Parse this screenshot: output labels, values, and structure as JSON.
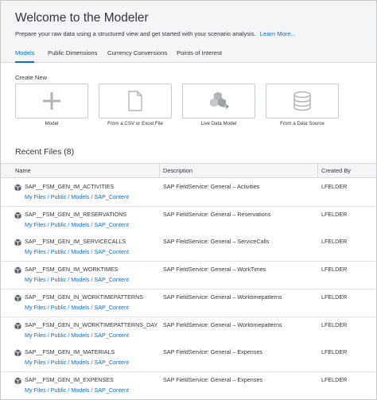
{
  "header": {
    "title": "Welcome to the Modeler",
    "subtitle": "Prepare your raw data using a structured view and get started with your scenario analysis.",
    "learn_more": "Learn More...",
    "tabs": [
      {
        "label": "Models",
        "active": true
      },
      {
        "label": "Public Dimensions",
        "active": false
      },
      {
        "label": "Currency Conversions",
        "active": false
      },
      {
        "label": "Points of Interest",
        "active": false
      }
    ]
  },
  "create_new": {
    "label": "Create New",
    "tiles": [
      {
        "label": "Model",
        "icon": "plus-icon"
      },
      {
        "label": "From a CSV or Excel File",
        "icon": "document-icon"
      },
      {
        "label": "Live Data Model",
        "icon": "live-data-icon"
      },
      {
        "label": "From a Data Source",
        "icon": "database-icon"
      }
    ]
  },
  "recent": {
    "title": "Recent Files (8)",
    "columns": [
      "Name",
      "Description",
      "Created By"
    ],
    "rows": [
      {
        "name": "SAP__FSM_GEN_IM_ACTIVITIES",
        "path": "My Files / Public / Models / SAP_Content",
        "description": "SAP FieldService: General – Activities",
        "created_by": "LFELDER"
      },
      {
        "name": "SAP__FSM_GEN_IM_RESERVATIONS",
        "path": "My Files / Public / Models / SAP_Content",
        "description": "SAP FieldService: General – Reservations",
        "created_by": "LFELDER"
      },
      {
        "name": "SAP__FSM_GEN_IM_SERVICECALLS",
        "path": "My Files / Public / Models / SAP_Content",
        "description": "SAP FieldService: General – ServiceCalls",
        "created_by": "LFELDER"
      },
      {
        "name": "SAP__FSM_GEN_IM_WORKTIMES",
        "path": "My Files / Public / Models / SAP_Content",
        "description": "SAP FieldService: General – WorkTimes",
        "created_by": "LFELDER"
      },
      {
        "name": "SAP__FSM_GEN_IN_WORKTIMEPATTERNS",
        "path": "My Files / Public / Models / SAP_Content",
        "description": "SAP FieldService: General – Worktimepatterns",
        "created_by": "LFELDER"
      },
      {
        "name": "SAP__FSM_GEN_IN_WORKTIMEPATTERNS_DAY",
        "path": "My Files / Public / Models / SAP_Content",
        "description": "SAP FieldService: General – Worktimepatterns",
        "created_by": "LFELDER"
      },
      {
        "name": "SAP__FSM_GEN_IM_MATERIALS",
        "path": "My Files / Public / Models / SAP_Content",
        "description": "SAP FieldService: General – Expenses",
        "created_by": "LFELDER"
      },
      {
        "name": "SAP__FSM_GEN_IM_EXPENSES",
        "path": "My Files / Public / Models / SAP_Content",
        "description": "SAP FieldService: General – Expenses",
        "created_by": "LFELDER"
      }
    ]
  },
  "colors": {
    "accent": "#0a6ed1",
    "header_bg": "#f4f5f7",
    "icon_gray": "#b0b4b8"
  }
}
